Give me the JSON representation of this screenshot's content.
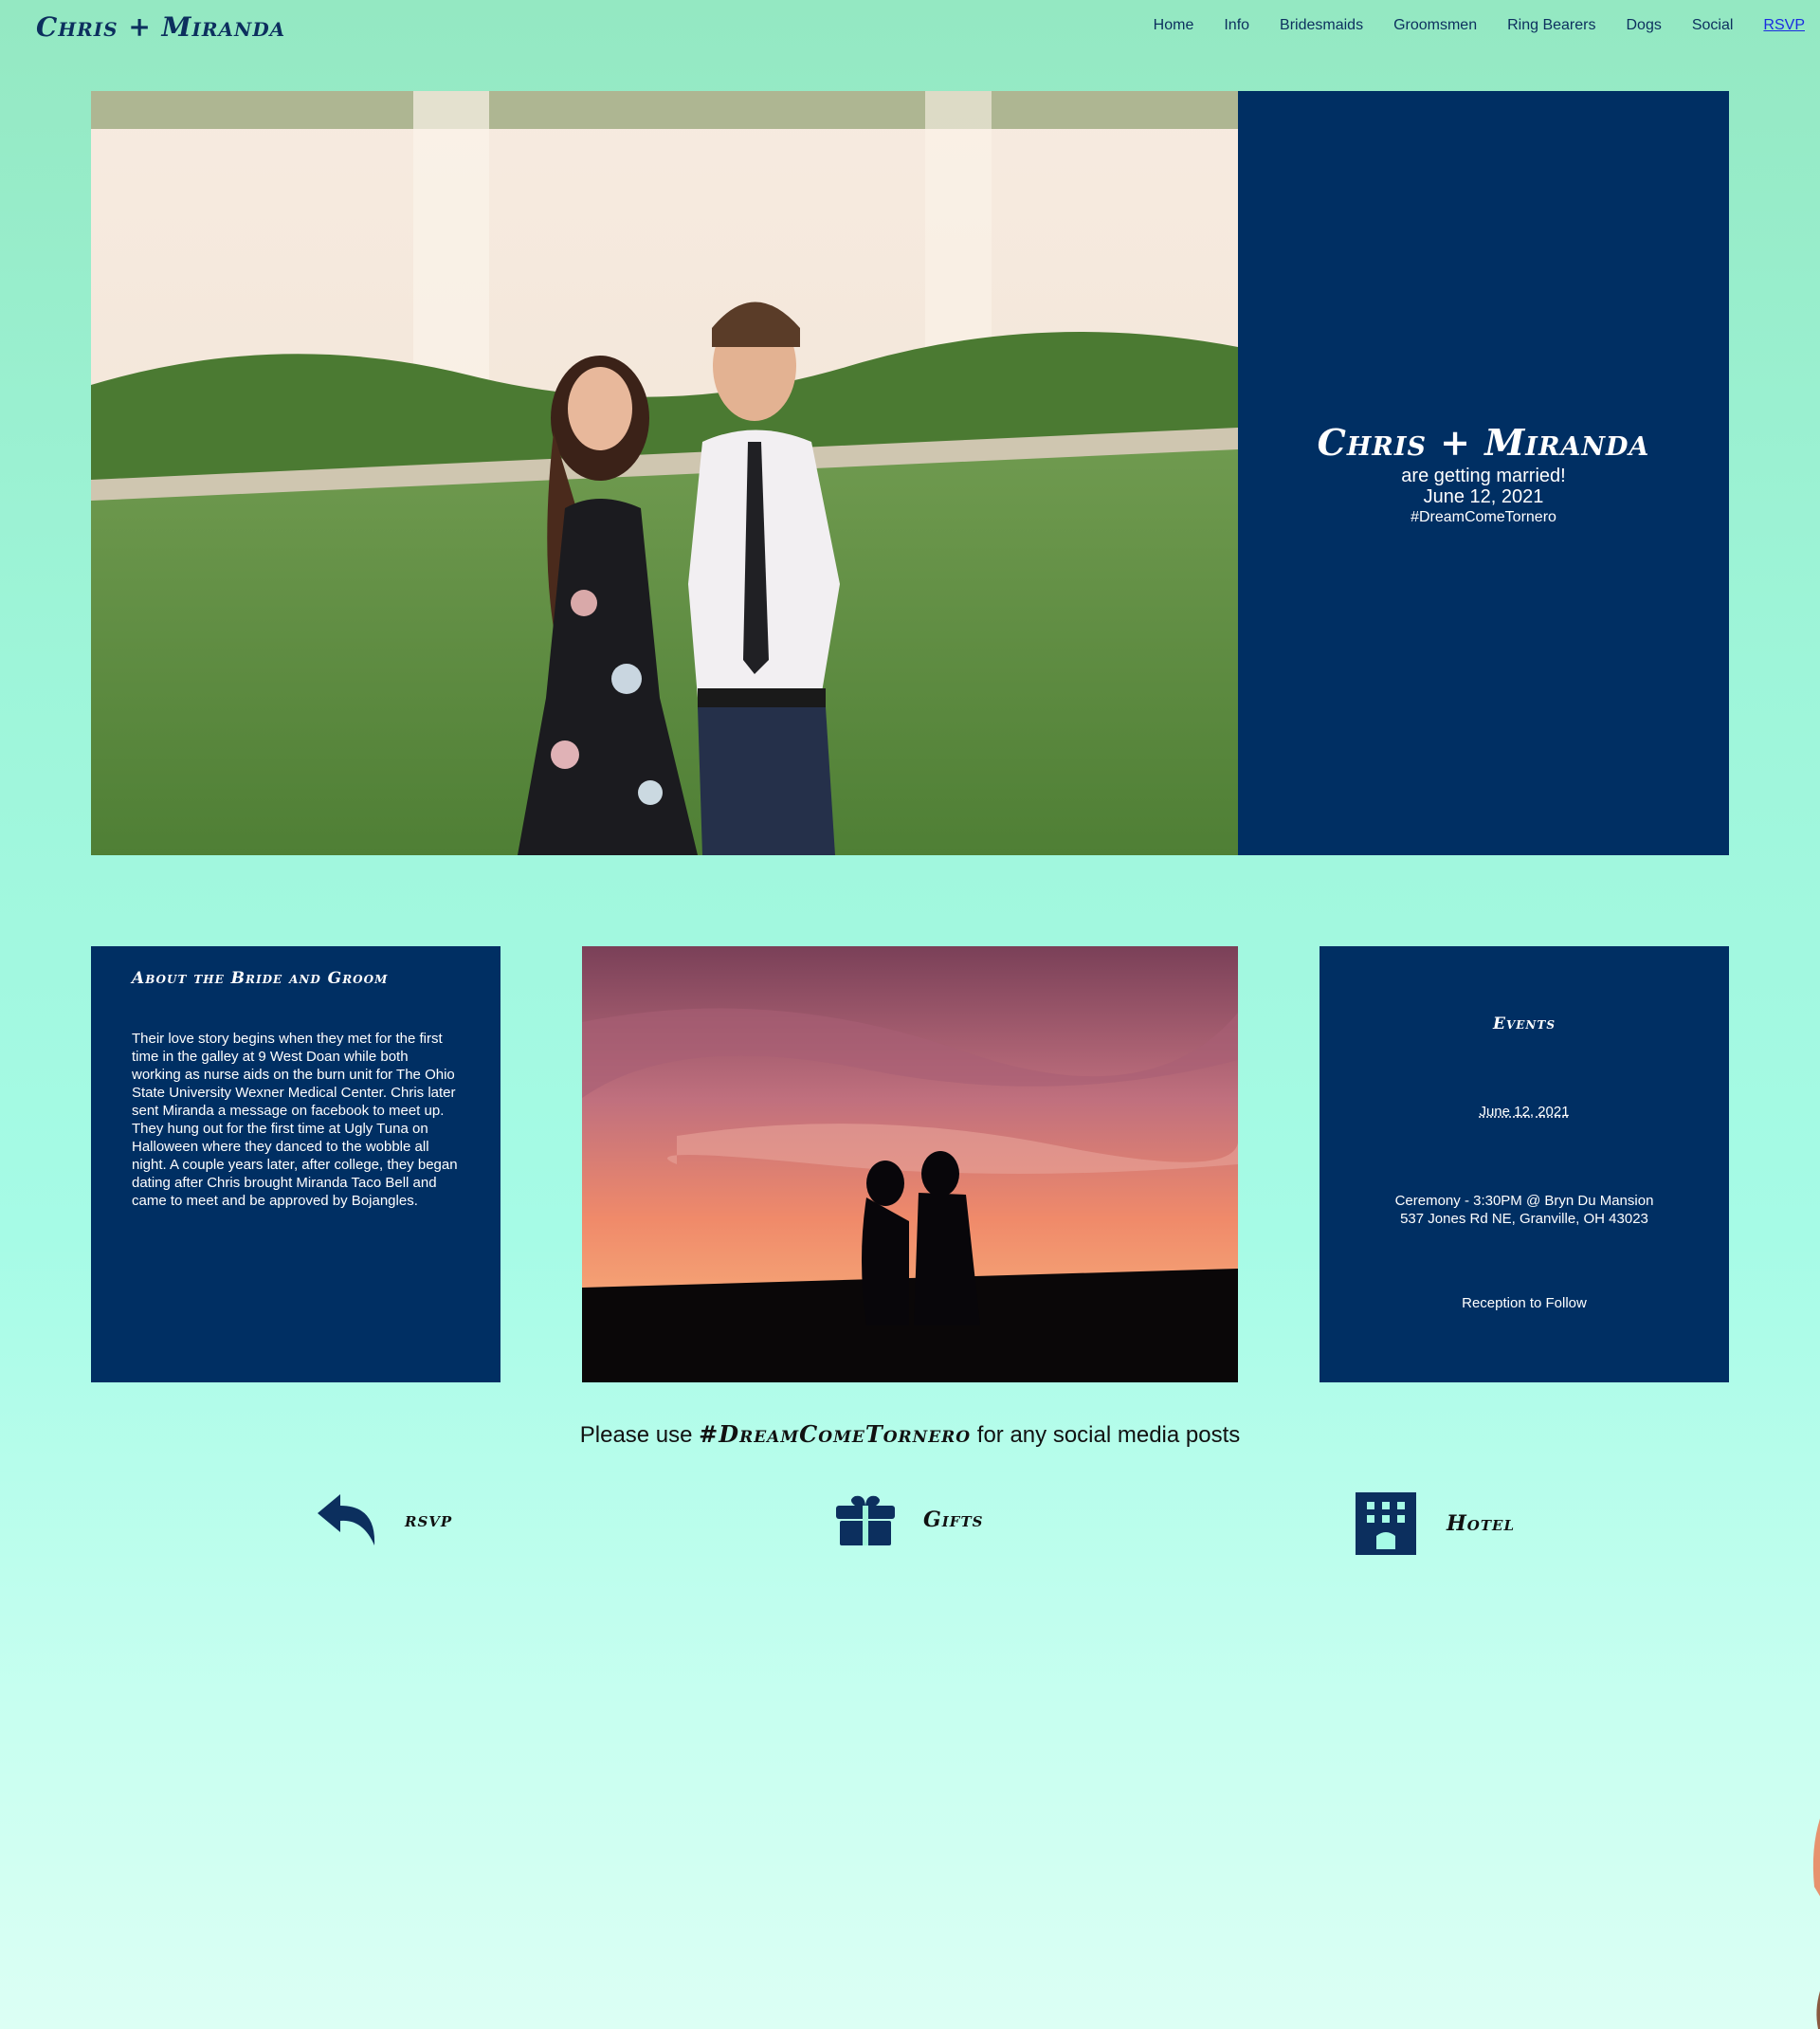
{
  "header": {
    "site_title": "Chris + Miranda",
    "nav": [
      "Home",
      "Info",
      "Bridesmaids",
      "Groomsmen",
      "Ring Bearers",
      "Dogs",
      "Social",
      "RSVP"
    ]
  },
  "hero": {
    "names": "Chris + Miranda",
    "subtitle": "are getting married!",
    "date": "June 12, 2021",
    "hashtag": "#DreamComeTornero"
  },
  "about": {
    "title": "About the Bride and Groom",
    "text": "Their love story begins when they met for the first time in the galley at 9 West Doan while both working as nurse aids on the burn unit for The Ohio State University Wexner Medical Center. Chris later sent Miranda a message on facebook to meet up. They hung out for the first time at Ugly Tuna on Halloween where they danced to the wobble all night. A couple years later, after college, they began dating after Chris brought Miranda Taco Bell and came to meet and be approved by Bojangles."
  },
  "events": {
    "title": "Events",
    "date": "June 12, 2021",
    "ceremony_line1": "Ceremony - 3:30PM @ Bryn Du Mansion",
    "ceremony_line2": "537 Jones Rd NE, Granville, OH 43023",
    "reception": "Reception to Follow"
  },
  "social": {
    "prefix": "Please use",
    "hashtag": "#DreamComeTornero",
    "suffix": "for any social media posts"
  },
  "links": [
    {
      "label": "rsvp",
      "icon": "reply-icon"
    },
    {
      "label": "Gifts",
      "icon": "gift-icon"
    },
    {
      "label": "Hotel",
      "icon": "hotel-icon"
    }
  ],
  "colors": {
    "navy": "#002f63",
    "mint_top": "#94e8c2",
    "mint_bottom": "#dcfff4",
    "rsvp_link": "#1a2be0"
  }
}
